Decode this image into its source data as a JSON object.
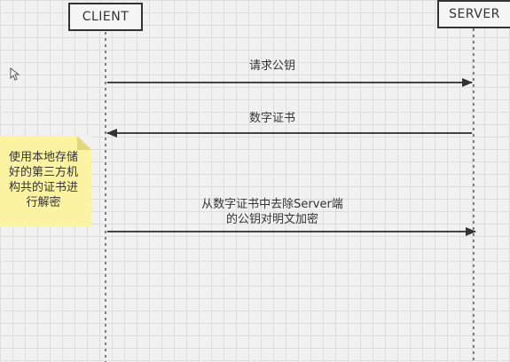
{
  "actors": {
    "client": "CLIENT",
    "server": "SERVER"
  },
  "messages": [
    {
      "label": "请求公钥",
      "direction": "client-to-server"
    },
    {
      "label": "数字证书",
      "direction": "server-to-client"
    },
    {
      "label": "从数字证书中去除Server端\n的公钥对明文加密",
      "direction": "client-to-server"
    }
  ],
  "note": {
    "text": "使用本地存储\n好的第三方机\n构共的证书进\n行解密",
    "color": "#fbf3a1"
  },
  "colors": {
    "line": "#333333",
    "grid": "#dcdcdc",
    "background": "#f1f1f1"
  }
}
